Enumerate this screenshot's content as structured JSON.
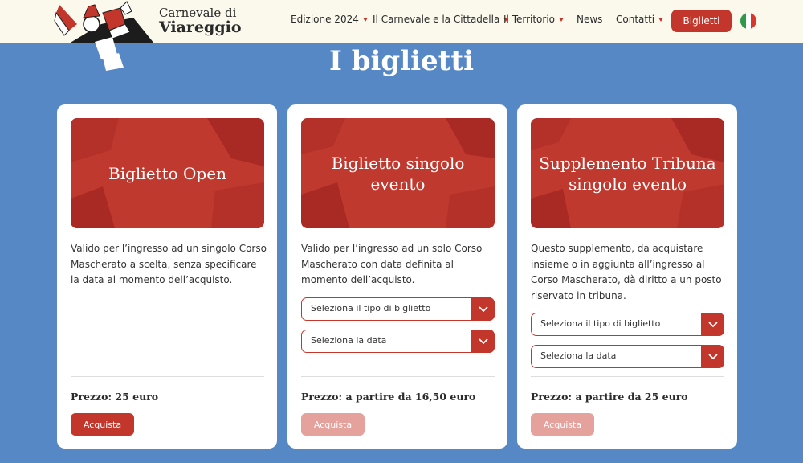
{
  "header": {
    "logo_line1": "Carnevale di",
    "logo_line2": "Viareggio",
    "nav": [
      {
        "label": "Edizione 2024",
        "has_caret": true
      },
      {
        "label": "Il Carnevale e la Cittadella",
        "has_caret": true
      },
      {
        "label": "Il Territorio",
        "has_caret": true
      },
      {
        "label": "News",
        "has_caret": false
      },
      {
        "label": "Contatti",
        "has_caret": true
      }
    ],
    "tickets_button": "Biglietti",
    "language_flag": "italian-flag-icon"
  },
  "main": {
    "title": "I biglietti",
    "cards": [
      {
        "banner_title": "Biglietto Open",
        "description": "Valido per l’ingresso ad un singolo Corso Mascherato a scelta, senza specificare la data al momento dell’acquisto.",
        "selects": [],
        "price": "Prezzo: 25 euro",
        "buy_label": "Acquista",
        "buy_enabled": true
      },
      {
        "banner_title": "Biglietto singolo evento",
        "description": "Valido per l’ingresso ad un solo Corso Mascherato con data definita al momento dell’acquisto.",
        "selects": [
          {
            "placeholder": "Seleziona il tipo di biglietto"
          },
          {
            "placeholder": "Seleziona la data"
          }
        ],
        "price": "Prezzo: a partire da 16,50 euro",
        "buy_label": "Acquista",
        "buy_enabled": false
      },
      {
        "banner_title": "Supplemento Tribuna singolo evento",
        "description": "Questo supplemento, da acquistare insieme o in aggiunta all’ingresso al Corso Mascherato, dà diritto a un posto riservato in tribuna.",
        "selects": [
          {
            "placeholder": "Seleziona il tipo di biglietto"
          },
          {
            "placeholder": "Seleziona la data"
          }
        ],
        "price": "Prezzo: a partire da 25 euro",
        "buy_label": "Acquista",
        "buy_enabled": false
      }
    ]
  },
  "colors": {
    "background": "#5588c4",
    "accent": "#c3362b",
    "disabled": "#e5a19c",
    "header_bg": "#fbf8ec"
  }
}
